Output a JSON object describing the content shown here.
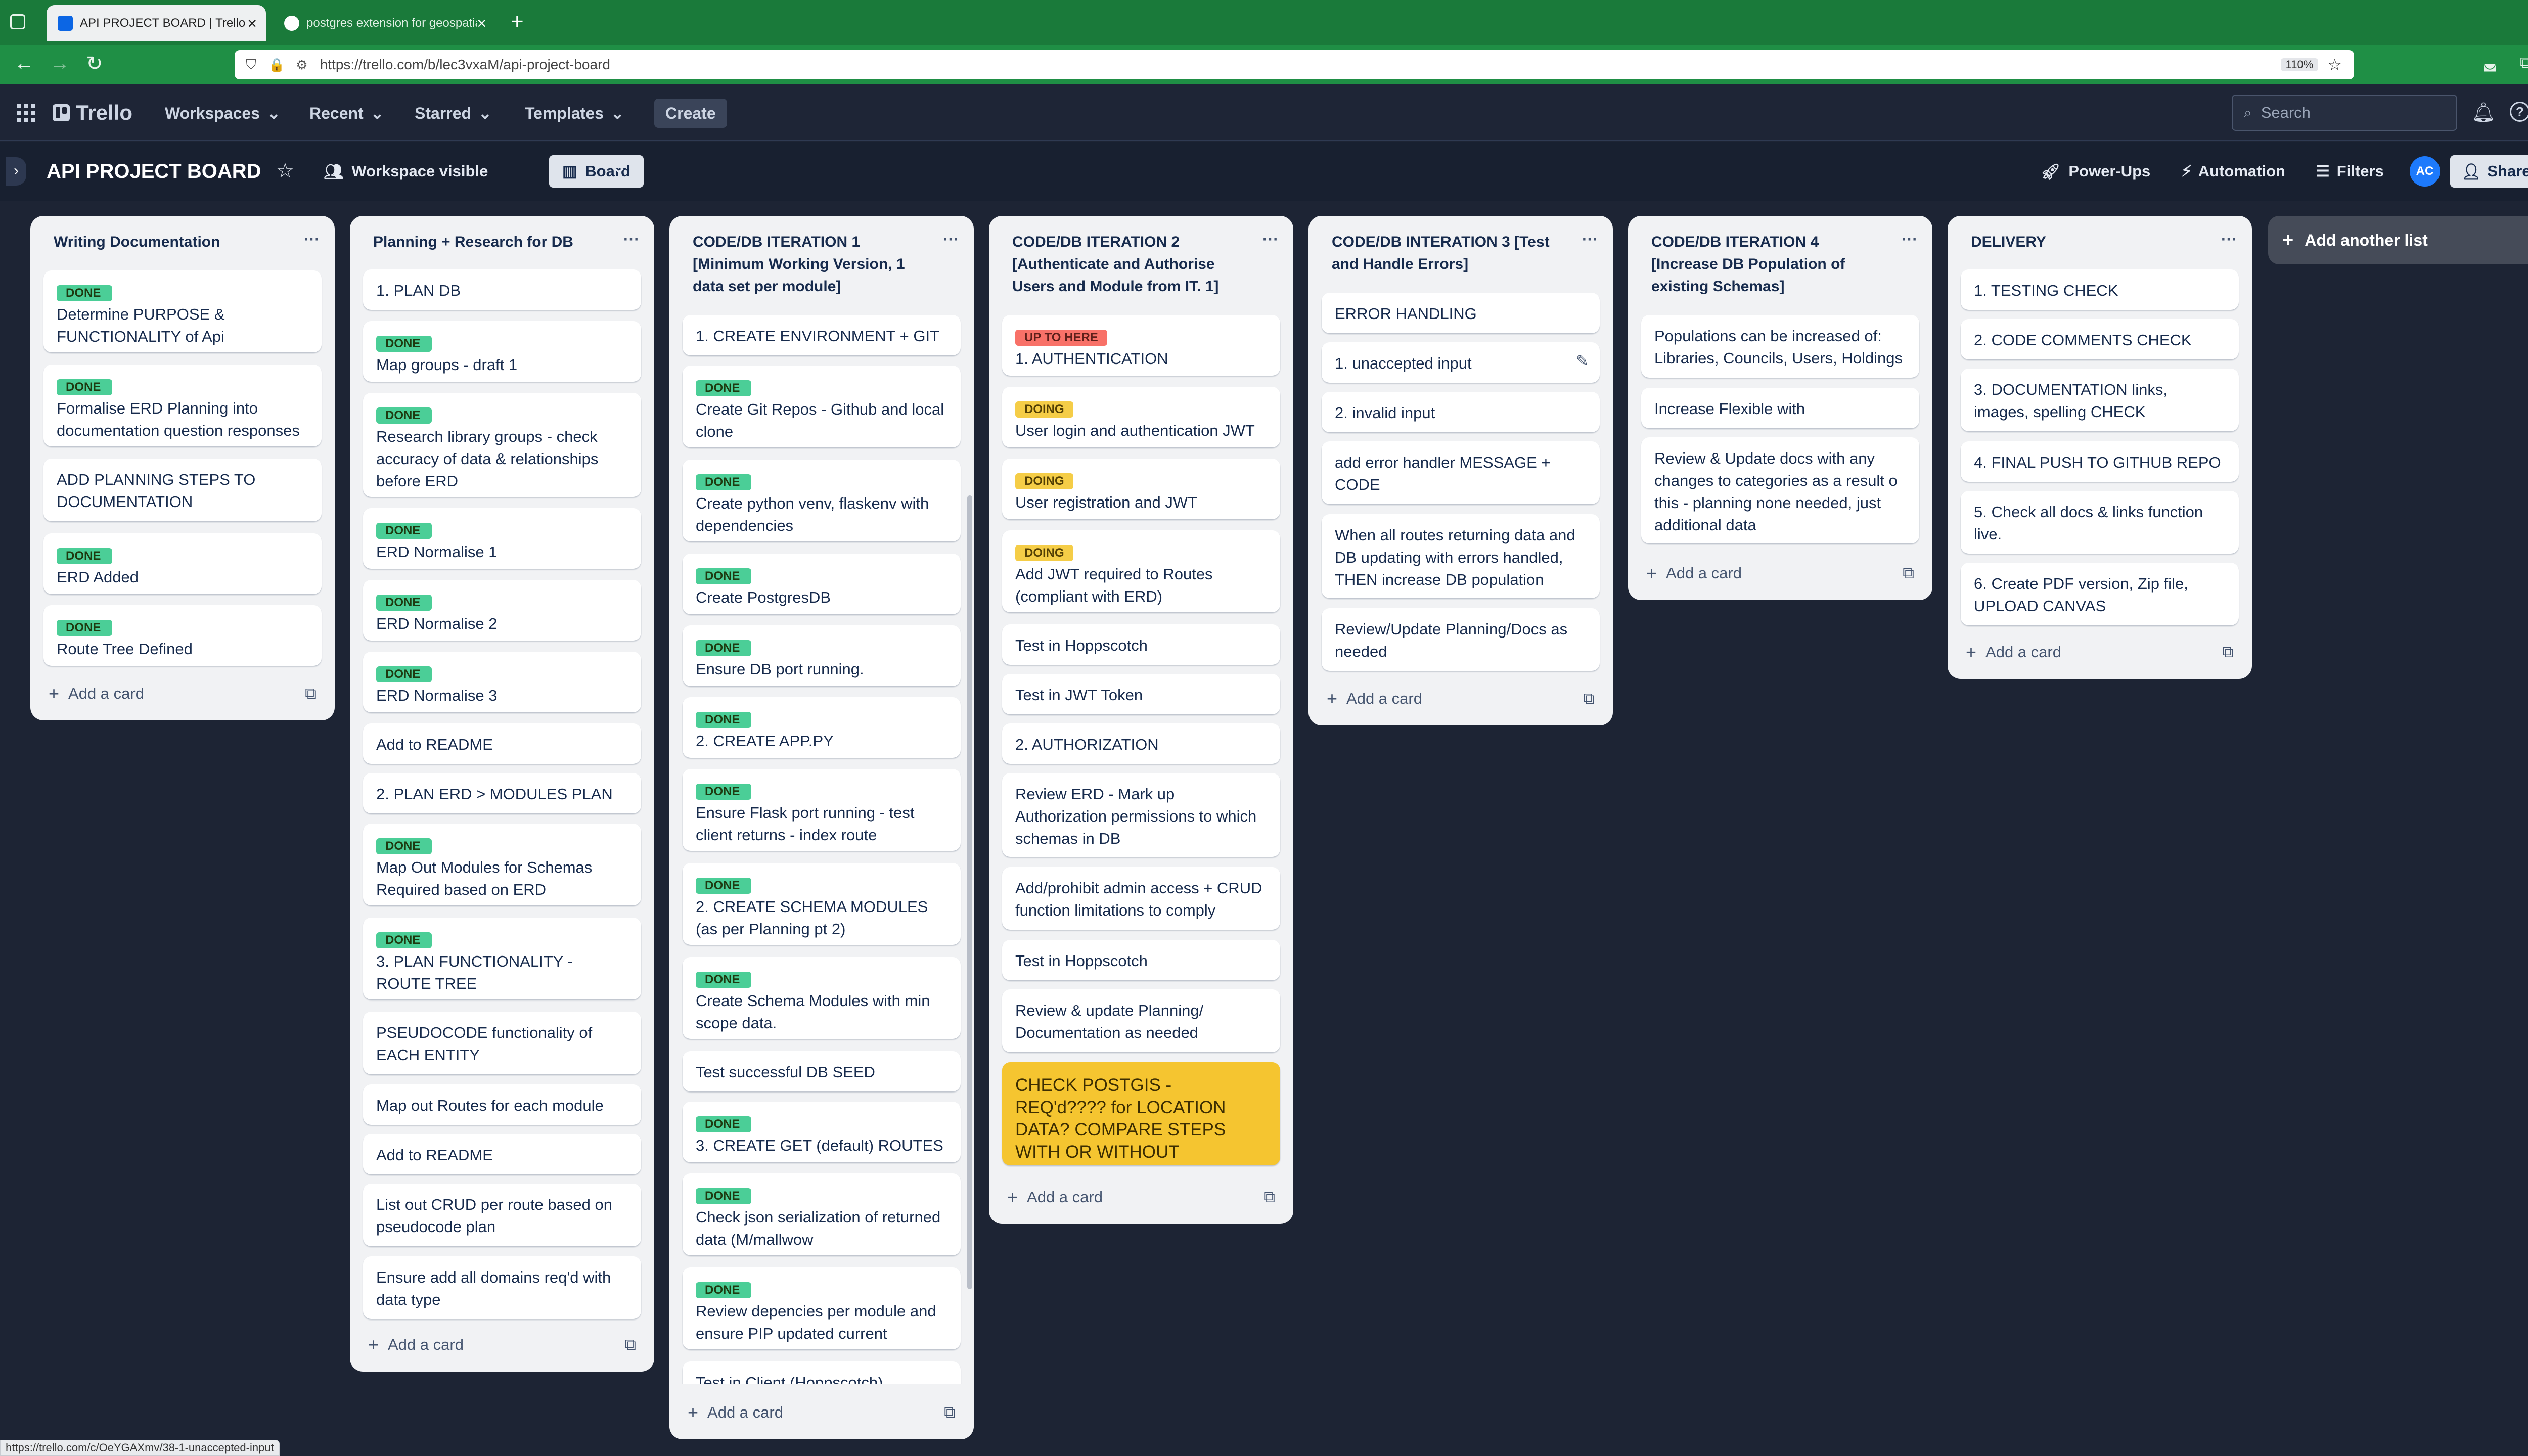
{
  "browser": {
    "tabs": [
      {
        "title": "API PROJECT BOARD | Trello",
        "active": true
      },
      {
        "title": "postgres extension for geospatial",
        "active": false
      }
    ],
    "url": "https://trello.com/b/lec3vxaM/api-project-board",
    "zoom": "110%",
    "status_url": "https://trello.com/c/OeYGAXmv/38-1-unaccepted-input"
  },
  "header": {
    "logo": "Trello",
    "nav": [
      "Workspaces",
      "Recent",
      "Starred",
      "Templates"
    ],
    "create": "Create",
    "search_placeholder": "Search",
    "avatar": "AC"
  },
  "board": {
    "title": "API PROJECT BOARD",
    "visibility": "Workspace visible",
    "view": "Board",
    "powerups": "Power-Ups",
    "automation": "Automation",
    "filters": "Filters",
    "share": "Share",
    "avatar": "AC",
    "add_list": "Add another list",
    "add_card": "Add a card"
  },
  "lists": [
    {
      "title": "Writing Documentation",
      "cards": [
        {
          "label": "DONE",
          "label_type": "done",
          "text": "Determine PURPOSE & FUNCTIONALITY of Api"
        },
        {
          "label": "DONE",
          "label_type": "done",
          "text": "Formalise ERD Planning into documentation question responses"
        },
        {
          "label": "",
          "label_type": "",
          "text": "ADD PLANNING STEPS TO DOCUMENTATION"
        },
        {
          "label": "DONE",
          "label_type": "done",
          "text": "ERD Added"
        },
        {
          "label": "DONE",
          "label_type": "done",
          "text": "Route Tree Defined"
        }
      ]
    },
    {
      "title": "Planning + Research for DB",
      "cards": [
        {
          "label": "",
          "label_type": "",
          "text": "1. PLAN DB"
        },
        {
          "label": "DONE",
          "label_type": "done",
          "text": "Map groups - draft 1"
        },
        {
          "label": "DONE",
          "label_type": "done",
          "text": "Research library groups - check accuracy of data & relationships before ERD"
        },
        {
          "label": "DONE",
          "label_type": "done",
          "text": "ERD Normalise 1"
        },
        {
          "label": "DONE",
          "label_type": "done",
          "text": "ERD Normalise 2"
        },
        {
          "label": "DONE",
          "label_type": "done",
          "text": "ERD Normalise 3"
        },
        {
          "label": "",
          "label_type": "",
          "text": "Add to README"
        },
        {
          "label": "",
          "label_type": "",
          "text": "2. PLAN ERD > MODULES PLAN"
        },
        {
          "label": "DONE",
          "label_type": "done",
          "text": "Map Out Modules for Schemas Required based on ERD"
        },
        {
          "label": "DONE",
          "label_type": "done",
          "text": "3. PLAN FUNCTIONALITY - ROUTE TREE"
        },
        {
          "label": "",
          "label_type": "",
          "text": "PSEUDOCODE functionality of EACH ENTITY"
        },
        {
          "label": "",
          "label_type": "",
          "text": "Map out Routes for each module"
        },
        {
          "label": "",
          "label_type": "",
          "text": "Add to README"
        },
        {
          "label": "",
          "label_type": "",
          "text": "List out CRUD per route based on pseudocode plan"
        },
        {
          "label": "",
          "label_type": "",
          "text": "Ensure add all domains req'd with data type"
        }
      ]
    },
    {
      "title": "CODE/DB ITERATION 1 [Minimum Working Version, 1 data set per module]",
      "cards": [
        {
          "label": "",
          "label_type": "",
          "text": "1. CREATE ENVIRONMENT + GIT"
        },
        {
          "label": "DONE",
          "label_type": "done",
          "text": "Create Git Repos - Github and local clone"
        },
        {
          "label": "DONE",
          "label_type": "done",
          "text": "Create python venv, flaskenv with dependencies"
        },
        {
          "label": "DONE",
          "label_type": "done",
          "text": "Create PostgresDB"
        },
        {
          "label": "DONE",
          "label_type": "done",
          "text": "Ensure DB port running."
        },
        {
          "label": "DONE",
          "label_type": "done",
          "text": "2. CREATE APP.PY"
        },
        {
          "label": "DONE",
          "label_type": "done",
          "text": "Ensure Flask port running - test client returns - index route"
        },
        {
          "label": "DONE",
          "label_type": "done",
          "text": "2. CREATE SCHEMA MODULES (as per Planning pt 2)"
        },
        {
          "label": "DONE",
          "label_type": "done",
          "text": "Create Schema Modules with min scope data."
        },
        {
          "label": "",
          "label_type": "",
          "text": "Test successful DB SEED"
        },
        {
          "label": "DONE",
          "label_type": "done",
          "text": "3. CREATE GET (default) ROUTES"
        },
        {
          "label": "DONE",
          "label_type": "done",
          "text": "Check json serialization of returned data (M/mallwow"
        },
        {
          "label": "DONE",
          "label_type": "done",
          "text": "Review depencies per module and ensure PIP updated current"
        },
        {
          "label": "",
          "label_type": "",
          "text": "Test in Client (Hoppscotch)"
        }
      ]
    },
    {
      "title": "CODE/DB ITERATION 2 [Authenticate and Authorise Users and Module from IT. 1]",
      "cards": [
        {
          "label": "UP TO HERE",
          "label_type": "up",
          "text": "1. AUTHENTICATION"
        },
        {
          "label": "DOING",
          "label_type": "doing",
          "text": "User login and authentication JWT"
        },
        {
          "label": "DOING",
          "label_type": "doing",
          "text": "User registration and JWT"
        },
        {
          "label": "DOING",
          "label_type": "doing",
          "text": "Add JWT required to Routes (compliant with ERD)"
        },
        {
          "label": "",
          "label_type": "",
          "text": "Test in Hoppscotch"
        },
        {
          "label": "",
          "label_type": "",
          "text": "Test in JWT Token"
        },
        {
          "label": "",
          "label_type": "",
          "text": "2. AUTHORIZATION"
        },
        {
          "label": "",
          "label_type": "",
          "text": "Review ERD - Mark up Authorization permissions to which schemas in DB"
        },
        {
          "label": "",
          "label_type": "",
          "text": "Add/prohibit admin access + CRUD function limitations to comply"
        },
        {
          "label": "",
          "label_type": "",
          "text": "Test in Hoppscotch"
        },
        {
          "label": "",
          "label_type": "",
          "text": "Review & update Planning/ Documentation as needed"
        },
        {
          "label": "",
          "label_type": "yellow",
          "text": "CHECK POSTGIS - REQ'd???? for LOCATION DATA? COMPARE STEPS WITH OR WITHOUT"
        }
      ]
    },
    {
      "title": "CODE/DB INTERATION 3 [Test and Handle Errors]",
      "cards": [
        {
          "label": "",
          "label_type": "",
          "text": "ERROR HANDLING"
        },
        {
          "label": "",
          "label_type": "",
          "text": "1. unaccepted input"
        },
        {
          "label": "",
          "label_type": "",
          "text": "2. invalid input"
        },
        {
          "label": "",
          "label_type": "",
          "text": "add error handler MESSAGE + CODE"
        },
        {
          "label": "",
          "label_type": "",
          "text": "When all routes returning data and DB updating with errors handled, THEN increase DB population"
        },
        {
          "label": "",
          "label_type": "",
          "text": "Review/Update Planning/Docs as needed"
        }
      ]
    },
    {
      "title": "CODE/DB ITERATION 4 [Increase DB Population of existing Schemas]",
      "cards": [
        {
          "label": "",
          "label_type": "",
          "text": "Populations can be increased of: Libraries, Councils, Users, Holdings"
        },
        {
          "label": "",
          "label_type": "",
          "text": "Increase Flexible with"
        },
        {
          "label": "",
          "label_type": "",
          "text": "Review & Update docs with any changes to categories as a result o this - planning none needed, just additional data"
        }
      ]
    },
    {
      "title": "DELIVERY",
      "cards": [
        {
          "label": "",
          "label_type": "",
          "text": "1. TESTING CHECK"
        },
        {
          "label": "",
          "label_type": "",
          "text": "2. CODE COMMENTS CHECK"
        },
        {
          "label": "",
          "label_type": "",
          "text": "3. DOCUMENTATION links, images, spelling CHECK"
        },
        {
          "label": "",
          "label_type": "",
          "text": "4. FINAL PUSH TO GITHUB REPO"
        },
        {
          "label": "",
          "label_type": "",
          "text": "5. Check all docs & links function live."
        },
        {
          "label": "",
          "label_type": "",
          "text": "6. Create PDF version, Zip file, UPLOAD CANVAS"
        }
      ]
    }
  ]
}
